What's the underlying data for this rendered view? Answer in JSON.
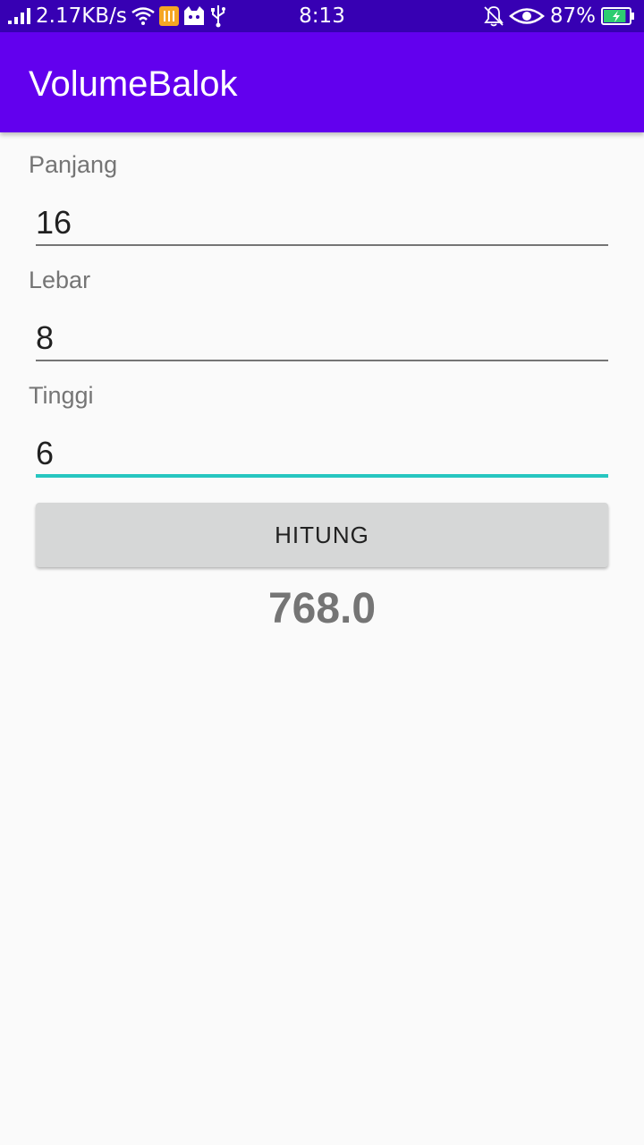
{
  "status_bar": {
    "network_speed": "2.17KB/s",
    "time": "8:13",
    "battery_percent": "87%",
    "battery_level": 0.87,
    "left_icons": [
      "signal-icon",
      "wifi-icon",
      "app-notification-icon",
      "cat-icon",
      "usb-icon"
    ],
    "right_icons": [
      "bell-muted-icon",
      "eye-icon",
      "battery-charging-icon"
    ]
  },
  "app_bar": {
    "title": "VolumeBalok",
    "color": "#6200ee"
  },
  "form": {
    "panjang": {
      "label": "Panjang",
      "value": "16"
    },
    "lebar": {
      "label": "Lebar",
      "value": "8"
    },
    "tinggi": {
      "label": "Tinggi",
      "value": "6"
    }
  },
  "button": {
    "label": "HITUNG"
  },
  "result": {
    "value": "768.0"
  },
  "colors": {
    "status_bar": "#3700b3",
    "accent": "#26c6c0",
    "battery": "#2ecc71"
  }
}
